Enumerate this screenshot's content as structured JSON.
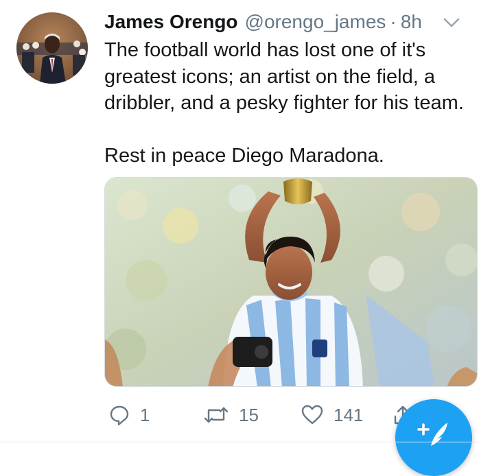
{
  "tweet": {
    "author_name": "James Orengo",
    "handle": "@orengo_james",
    "separator": "·",
    "time": "8h",
    "text": "The football world has lost one of it's greatest icons; an artist on the field, a dribbler, and a pesky fighter for his team.\n\nRest in peace Diego Maradona.",
    "media_icon": "photo",
    "avatar_icon": "avatar"
  },
  "actions": {
    "reply_count": "1",
    "retweet_count": "15",
    "like_count": "141"
  },
  "icons": {
    "menu": "chevron-down-icon",
    "reply": "reply-icon",
    "retweet": "retweet-icon",
    "like": "heart-icon",
    "share": "share-icon",
    "compose": "compose-icon"
  },
  "colors": {
    "accent": "#1da1f2",
    "secondary_text": "#657786",
    "primary_text": "#14171a"
  }
}
